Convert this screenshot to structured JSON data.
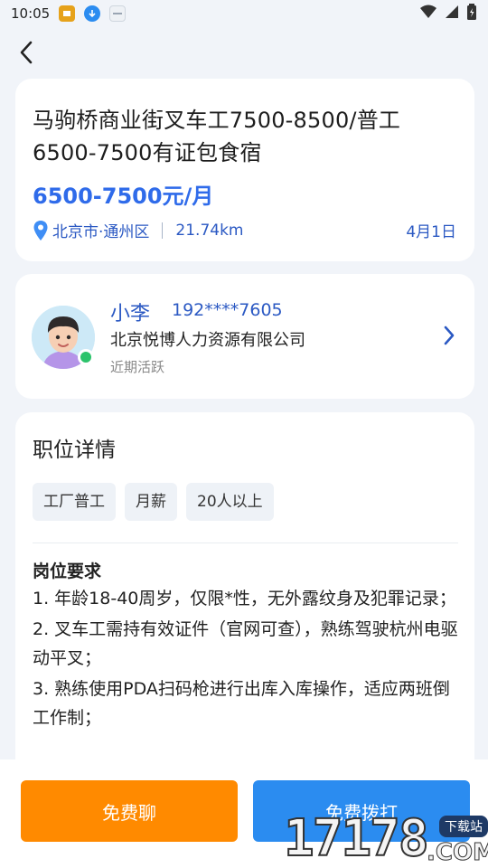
{
  "status_bar": {
    "time": "10:05",
    "icons": [
      "notification-app-icon",
      "download-icon",
      "app-badge-icon",
      "wifi-icon",
      "signal-icon",
      "battery-icon"
    ]
  },
  "header": {
    "back_icon": "chevron-left-icon"
  },
  "job": {
    "title": "马驹桥商业街叉车工7500-8500/普工6500-7500有证包食宿",
    "salary": "6500-7500元/月",
    "location": "北京市·通州区",
    "distance": "21.74km",
    "date": "4月1日"
  },
  "contact": {
    "name": "小李",
    "phone": "192****7605",
    "company": "北京悦博人力资源有限公司",
    "status": "近期活跃"
  },
  "details": {
    "section_title": "职位详情",
    "tags": [
      "工厂普工",
      "月薪",
      "20人以上"
    ],
    "requirements_title": "岗位要求",
    "requirements": [
      "1. 年龄18-40周岁，仅限*性，无外露纹身及犯罪记录；",
      "2. 叉车工需持有效证件（官网可查），熟练驾驶杭州电驱动平叉；",
      "3. 熟练使用PDA扫码枪进行出库入库操作，适应两班倒工作制；"
    ]
  },
  "actions": {
    "chat_label": "免费聊",
    "call_label": "免费拨打"
  },
  "watermark": {
    "digits": "17178",
    "suffix": ".COM",
    "tag": "下载站"
  },
  "colors": {
    "accent_blue": "#2f6bea",
    "chat_orange": "#ff8a00",
    "call_blue": "#2b8cf0",
    "online_green": "#2cc36b"
  }
}
